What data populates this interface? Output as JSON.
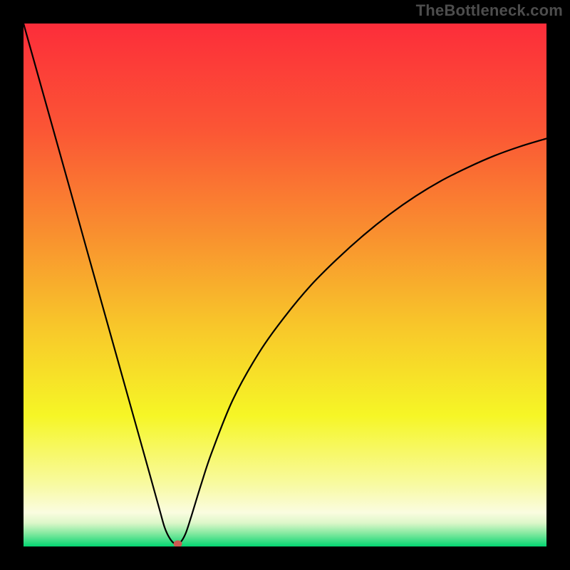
{
  "attribution": "TheBottleneck.com",
  "colors": {
    "bg": "#000000",
    "attribution_text": "#4d4d4d",
    "curve_stroke": "#000000",
    "marker_fill": "#cc5a52",
    "gradient_stops": [
      {
        "offset": 0.0,
        "color": "#fc2d3a"
      },
      {
        "offset": 0.2,
        "color": "#fb5535"
      },
      {
        "offset": 0.4,
        "color": "#f98f2f"
      },
      {
        "offset": 0.58,
        "color": "#f8c72a"
      },
      {
        "offset": 0.75,
        "color": "#f6f626"
      },
      {
        "offset": 0.88,
        "color": "#f8faa0"
      },
      {
        "offset": 0.935,
        "color": "#fafce0"
      },
      {
        "offset": 0.955,
        "color": "#ddf7c9"
      },
      {
        "offset": 0.975,
        "color": "#84e9a0"
      },
      {
        "offset": 1.0,
        "color": "#03d571"
      }
    ]
  },
  "chart_data": {
    "type": "line",
    "title": "",
    "xlabel": "",
    "ylabel": "",
    "xlim": [
      0,
      100
    ],
    "ylim": [
      0,
      100
    ],
    "x": [
      0,
      3,
      6,
      9,
      12,
      15,
      18,
      21,
      24,
      26,
      27,
      28,
      29,
      30,
      31,
      32,
      34,
      36,
      40,
      45,
      50,
      55,
      60,
      65,
      70,
      75,
      80,
      85,
      90,
      95,
      100
    ],
    "values": [
      100,
      89.3,
      78.6,
      67.9,
      57.1,
      46.4,
      35.7,
      25.0,
      14.3,
      7.1,
      3.6,
      1.5,
      0.5,
      0.8,
      2.5,
      5.5,
      12.0,
      18.0,
      28.0,
      37.0,
      44.0,
      50.0,
      55.0,
      59.5,
      63.5,
      67.0,
      70.0,
      72.5,
      74.7,
      76.5,
      78.0
    ],
    "marker": {
      "x": 29.5,
      "y": 0.5
    },
    "notes": "V-shaped bottleneck curve plotted over a vertical red-to-green gradient; minimum near x≈29 y≈0; right branch asymptotes toward ~78% at x=100. Axis values are estimated from visual proportions (no tick labels present)."
  }
}
